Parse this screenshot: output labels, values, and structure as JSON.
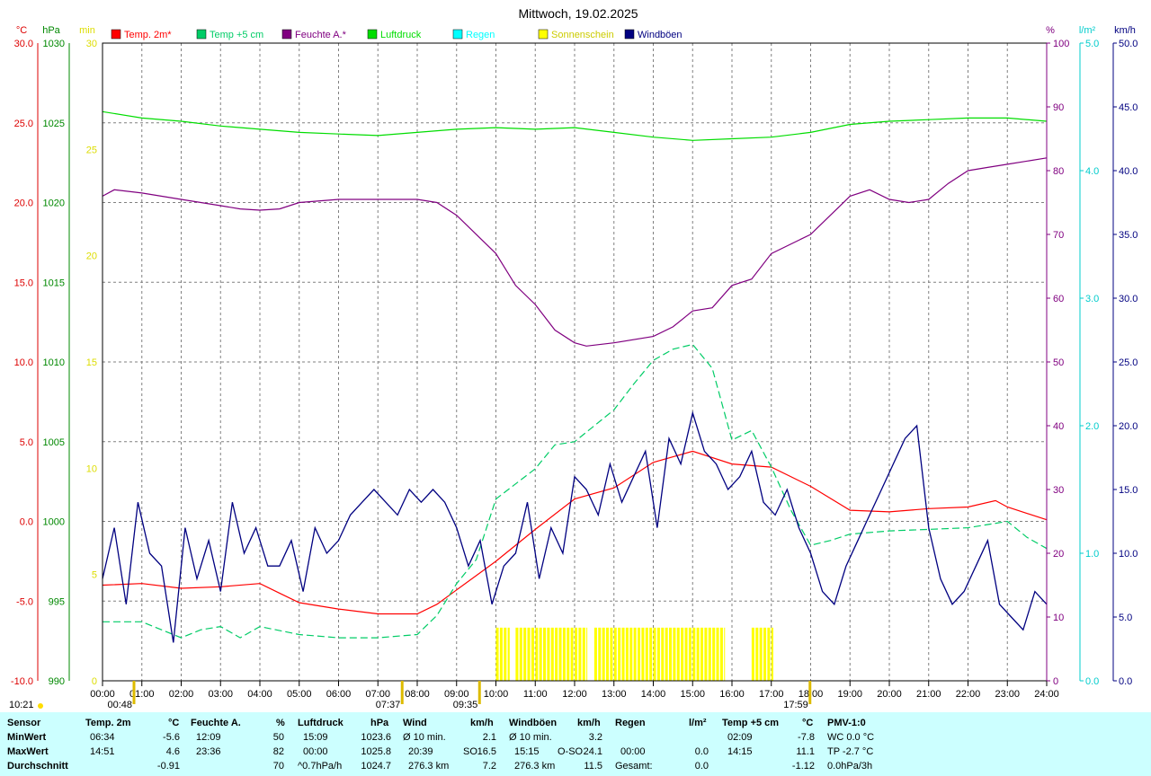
{
  "chart_data": {
    "type": "line",
    "title": "Mittwoch, 19.02.2025",
    "x_ticks": [
      "00:00",
      "01:00",
      "02:00",
      "03:00",
      "04:00",
      "05:00",
      "06:00",
      "07:00",
      "08:00",
      "09:00",
      "10:00",
      "11:00",
      "12:00",
      "13:00",
      "14:00",
      "15:00",
      "16:00",
      "17:00",
      "18:00",
      "19:00",
      "20:00",
      "21:00",
      "22:00",
      "23:00",
      "24:00"
    ],
    "xlim": [
      0,
      24
    ],
    "grid": true,
    "legend_position": "top",
    "axes": {
      "temp": {
        "unit": "°C",
        "ylim": [
          -10,
          30
        ],
        "ticks": [
          "30.0",
          "25.0",
          "20.0",
          "15.0",
          "10.0",
          "5.0",
          "0.0",
          "-5.0",
          "-10.0"
        ],
        "color": "#dd0000"
      },
      "pressure": {
        "unit": "hPa",
        "ylim": [
          990,
          1030
        ],
        "ticks": [
          "1030",
          "1025",
          "1020",
          "1015",
          "1010",
          "1005",
          "1000",
          "995",
          "990"
        ],
        "color": "#008800"
      },
      "sunshine": {
        "unit": "min",
        "ylim": [
          0,
          30
        ],
        "ticks": [
          "30",
          "25",
          "20",
          "15",
          "10",
          "5",
          "0"
        ],
        "color": "#dddd00"
      },
      "humidity": {
        "unit": "%",
        "ylim": [
          0,
          100
        ],
        "ticks": [
          "100",
          "90",
          "80",
          "70",
          "60",
          "50",
          "40",
          "30",
          "20",
          "10",
          "0"
        ],
        "color": "#800080"
      },
      "rain": {
        "unit": "l/m²",
        "ylim": [
          0,
          5
        ],
        "ticks": [
          "5.0",
          "4.0",
          "3.0",
          "2.0",
          "1.0",
          "0.0"
        ],
        "color": "#00cccc"
      },
      "wind": {
        "unit": "km/h",
        "ylim": [
          0,
          50
        ],
        "ticks": [
          "50.0",
          "45.0",
          "40.0",
          "35.0",
          "30.0",
          "25.0",
          "20.0",
          "15.0",
          "10.0",
          "5.0",
          "0.0"
        ],
        "color": "#000080"
      }
    },
    "legend": [
      {
        "label": "Temp. 2m*",
        "color": "#ff0000"
      },
      {
        "label": "Temp +5 cm",
        "color": "#00cc66"
      },
      {
        "label": "Feuchte A.*",
        "color": "#800080"
      },
      {
        "label": "Luftdruck",
        "color": "#00dd00"
      },
      {
        "label": "Regen",
        "color": "#00ffff"
      },
      {
        "label": "Sonnenschein",
        "color": "#ffff00"
      },
      {
        "label": "Windböen",
        "color": "#000080"
      }
    ],
    "series": [
      {
        "name": "Temp. 2m*",
        "axis": "temp",
        "x": [
          0,
          1,
          2,
          3,
          4,
          4.5,
          5,
          6,
          7,
          8,
          8.5,
          9,
          10,
          11,
          12,
          13,
          14,
          15,
          16,
          17,
          18,
          19,
          20,
          21,
          22,
          22.7,
          23,
          24
        ],
        "y": [
          -4,
          -3.9,
          -4.2,
          -4.1,
          -3.9,
          -4.5,
          -5.1,
          -5.5,
          -5.8,
          -5.8,
          -5.2,
          -4.3,
          -2.5,
          -0.5,
          1.4,
          2.1,
          3.7,
          4.4,
          3.6,
          3.4,
          2.2,
          0.7,
          0.6,
          0.8,
          0.9,
          1.3,
          0.9,
          0.1
        ]
      },
      {
        "name": "Temp +5 cm",
        "axis": "temp",
        "x": [
          0,
          1,
          1.5,
          2,
          2.5,
          3,
          3.5,
          4,
          5,
          6,
          7,
          8,
          8.5,
          9,
          9.5,
          10,
          11,
          11.5,
          12,
          13,
          13.5,
          14,
          14.5,
          15,
          15.5,
          16,
          16.5,
          17,
          17.5,
          18,
          18.5,
          19,
          20,
          21,
          22,
          23,
          23.5,
          24
        ],
        "y": [
          -6.3,
          -6.3,
          -6.8,
          -7.3,
          -6.8,
          -6.6,
          -7.3,
          -6.6,
          -7.1,
          -7.3,
          -7.3,
          -7.1,
          -5.9,
          -3.9,
          -2.4,
          1.4,
          3.3,
          4.8,
          5,
          7,
          8.6,
          10.1,
          10.8,
          11.1,
          9.6,
          5.1,
          5.7,
          3.4,
          0.7,
          -1.5,
          -1.2,
          -0.8,
          -0.6,
          -0.5,
          -0.4,
          0,
          -1.0,
          -1.7
        ]
      },
      {
        "name": "Feuchte A.*",
        "axis": "humidity",
        "x": [
          0,
          0.3,
          1,
          2,
          2.5,
          3,
          3.5,
          4,
          4.5,
          5,
          6,
          7,
          8,
          8.5,
          9,
          10,
          10.5,
          11,
          11.5,
          12,
          12.3,
          13,
          14,
          14.5,
          15,
          15.5,
          16,
          16.5,
          17,
          18,
          19,
          19.5,
          20,
          20.5,
          21,
          21.5,
          22,
          22.5,
          23,
          24
        ],
        "y": [
          76,
          77,
          76.5,
          75.5,
          75,
          74.5,
          74,
          73.8,
          74,
          75,
          75.5,
          75.5,
          75.5,
          75,
          73,
          67,
          62,
          59,
          55,
          53,
          52.5,
          53,
          54,
          55.5,
          58,
          58.5,
          62,
          63,
          67,
          70,
          76,
          77,
          75.5,
          75,
          75.5,
          78,
          80,
          80.5,
          81,
          82
        ]
      },
      {
        "name": "Luftdruck",
        "axis": "pressure",
        "x": [
          0,
          1,
          2,
          3,
          4,
          5,
          6,
          7,
          8,
          9,
          10,
          11,
          12,
          13,
          14,
          15,
          16,
          17,
          18,
          19,
          20,
          21,
          22,
          23,
          24
        ],
        "y": [
          1025.7,
          1025.3,
          1025.1,
          1024.8,
          1024.6,
          1024.4,
          1024.3,
          1024.2,
          1024.4,
          1024.6,
          1024.7,
          1024.6,
          1024.7,
          1024.4,
          1024.1,
          1023.9,
          1024,
          1024.1,
          1024.4,
          1024.9,
          1025.1,
          1025.2,
          1025.3,
          1025.3,
          1025.1
        ]
      },
      {
        "name": "Windböen",
        "axis": "wind",
        "x": [
          0,
          0.3,
          0.6,
          0.9,
          1.2,
          1.5,
          1.8,
          2.1,
          2.4,
          2.7,
          3,
          3.3,
          3.6,
          3.9,
          4.2,
          4.5,
          4.8,
          5.1,
          5.4,
          5.7,
          6,
          6.3,
          6.6,
          6.9,
          7.2,
          7.5,
          7.8,
          8.1,
          8.4,
          8.7,
          9,
          9.3,
          9.6,
          9.9,
          10.2,
          10.5,
          10.8,
          11.1,
          11.4,
          11.7,
          12,
          12.3,
          12.6,
          12.9,
          13.2,
          13.5,
          13.8,
          14.1,
          14.4,
          14.7,
          15,
          15.3,
          15.6,
          15.9,
          16.2,
          16.5,
          16.8,
          17.1,
          17.4,
          17.7,
          18,
          18.3,
          18.6,
          18.9,
          19.2,
          19.5,
          19.8,
          20.1,
          20.4,
          20.7,
          21,
          21.3,
          21.6,
          21.9,
          22.2,
          22.5,
          22.8,
          23.1,
          23.4,
          23.7,
          24
        ],
        "y": [
          8,
          12,
          6,
          14,
          10,
          9,
          3,
          12,
          8,
          11,
          7,
          14,
          10,
          12,
          9,
          9,
          11,
          7,
          12,
          10,
          11,
          13,
          14,
          15,
          14,
          13,
          15,
          14,
          15,
          14,
          12,
          9,
          11,
          6,
          9,
          10,
          14,
          8,
          12,
          10,
          16,
          15,
          13,
          17,
          14,
          16,
          18,
          12,
          19,
          17,
          21,
          18,
          17,
          15,
          16,
          18,
          14,
          13,
          15,
          12,
          10,
          7,
          6,
          9,
          11,
          13,
          15,
          17,
          19,
          20,
          12,
          8,
          6,
          7,
          9,
          11,
          6,
          5,
          4,
          7,
          6
        ]
      }
    ],
    "sunshine_blocks": [
      [
        10.0,
        10.35
      ],
      [
        10.5,
        12.3
      ],
      [
        12.5,
        15.8
      ],
      [
        16.5,
        17.05
      ]
    ],
    "sunshine_level_min": 2.5,
    "sun_markers": [
      {
        "label": "00:48",
        "x": 0.8
      },
      {
        "label": "07:37",
        "x": 7.617
      },
      {
        "label": "09:35",
        "x": 9.583
      },
      {
        "label": "17:59",
        "x": 17.983
      }
    ],
    "bottom_left_time": "10:21"
  },
  "table": {
    "rows": [
      "Sensor",
      "MinWert",
      "MaxWert",
      "Durchschnitt"
    ],
    "temp2m": {
      "title": "Temp. 2m",
      "unit": "°C",
      "min_time": "06:34",
      "min": "-5.6",
      "max_time": "14:51",
      "max": "4.6",
      "avg": "-0.91"
    },
    "humidity": {
      "title": "Feuchte A.",
      "unit": "%",
      "min_time": "12:09",
      "min": "50",
      "max_time": "23:36",
      "max": "82",
      "avg": "70"
    },
    "pressure": {
      "title": "Luftdruck",
      "unit": "hPa",
      "min_time": "15:09",
      "min": "1023.6",
      "max_time": "00:00",
      "max": "1025.8",
      "avg_note": "^0.7hPa/h",
      "avg": "1024.7"
    },
    "wind": {
      "title": "Wind",
      "unit": "km/h",
      "min_label": "Ø 10 min.",
      "min": "2.1",
      "max_time": "20:39",
      "max_dir": "SO",
      "max": "16.5",
      "avg_label": "276.3 km",
      "avg": "7.2"
    },
    "gusts": {
      "title": "Windböen",
      "unit": "km/h",
      "min_label": "Ø 10 min.",
      "min": "3.2",
      "max_time": "15:15",
      "max_dir": "O-SO",
      "max": "24.1",
      "avg_label": "276.3 km",
      "avg": "11.5"
    },
    "rain": {
      "title": "Regen",
      "unit": "l/m²",
      "max_time": "00:00",
      "max": "0.0",
      "total_label": "Gesamt:",
      "total": "0.0"
    },
    "temp5": {
      "title": "Temp +5 cm",
      "unit": "°C",
      "min_time": "02:09",
      "min": "-7.8",
      "max_time": "14:15",
      "max": "11.1",
      "avg": "-1.12"
    },
    "pmv": {
      "title": "PMV-1:0",
      "wc": "WC 0.0 °C",
      "tp": "TP -2.7 °C",
      "trend": "0.0hPa/3h"
    }
  }
}
